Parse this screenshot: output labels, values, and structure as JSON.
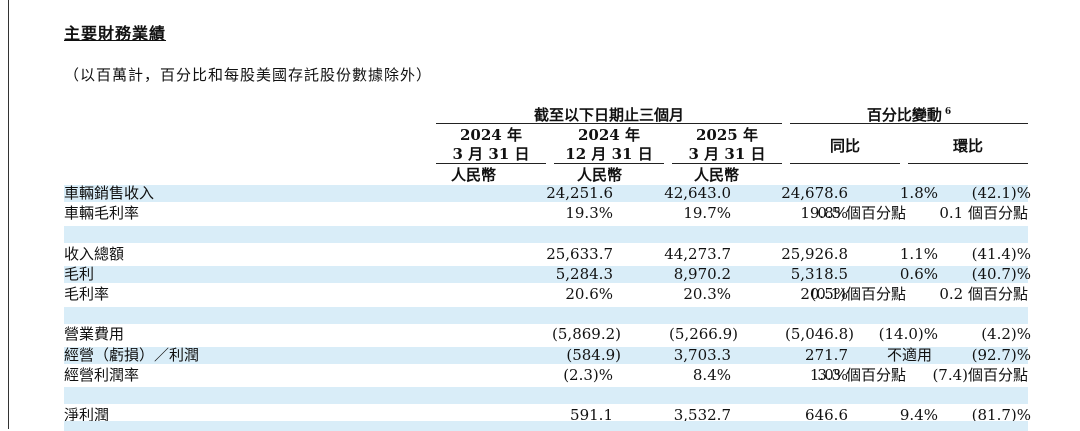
{
  "title": "主要財務業績",
  "subtitle": "（以百萬計，百分比和每股美國存託股份數據除外）",
  "header": {
    "group1": "截至以下日期止三個月",
    "group2": "百分比變動",
    "group2_note": "6",
    "periods": [
      {
        "year": "2024 年",
        "date": "3 月 31 日",
        "currency": "人民幣"
      },
      {
        "year": "2024 年",
        "date": "12 月 31 日",
        "currency": "人民幣"
      },
      {
        "year": "2025 年",
        "date": "3 月 31 日",
        "currency": "人民幣"
      }
    ],
    "yoy": "同比",
    "qoq": "環比"
  },
  "rows": [
    {
      "label": "車輛銷售收入",
      "v1": "24,251.6",
      "v2": "42,643.0",
      "v3": "24,678.6",
      "yoy": "1.8%",
      "qoq": "(42.1)%"
    },
    {
      "label": "車輛毛利率",
      "v1": "19.3%",
      "v2": "19.7%",
      "v3": "19.8%",
      "yoy": "0.5 個百分點",
      "qoq": "0.1 個百分點"
    },
    {
      "label": "收入總額",
      "v1": "25,633.7",
      "v2": "44,273.7",
      "v3": "25,926.8",
      "yoy": "1.1%",
      "qoq": "(41.4)%"
    },
    {
      "label": "毛利",
      "v1": "5,284.3",
      "v2": "8,970.2",
      "v3": "5,318.5",
      "yoy": "0.6%",
      "qoq": "(40.7)%"
    },
    {
      "label": "毛利率",
      "v1": "20.6%",
      "v2": "20.3%",
      "v3": "20.5%",
      "yoy": "(0.1)個百分點",
      "qoq": "0.2 個百分點"
    },
    {
      "label": "營業費用",
      "v1": "(5,869.2)",
      "v2": "(5,266.9)",
      "v3": "(5,046.8)",
      "yoy": "(14.0)%",
      "qoq": "(4.2)%"
    },
    {
      "label": "經營（虧損）／利潤",
      "v1": "(584.9)",
      "v2": "3,703.3",
      "v3": "271.7",
      "yoy": "不適用",
      "qoq": "(92.7)%"
    },
    {
      "label": "經營利潤率",
      "v1": "(2.3)%",
      "v2": "8.4%",
      "v3": "1.0%",
      "yoy": "3.3 個百分點",
      "qoq": "(7.4)個百分點"
    },
    {
      "label": "淨利潤",
      "v1": "591.1",
      "v2": "3,532.7",
      "v3": "646.6",
      "yoy": "9.4%",
      "qoq": "(81.7)%"
    }
  ]
}
